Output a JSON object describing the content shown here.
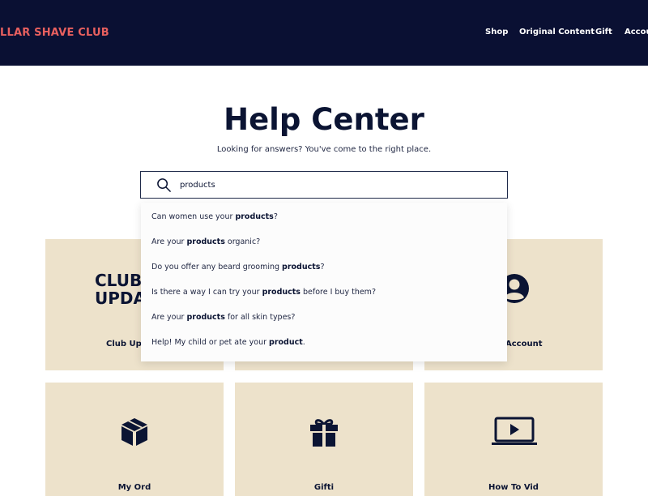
{
  "header": {
    "logo": "LLAR SHAVE CLUB",
    "nav": [
      "Shop",
      "Original Content",
      "Gift",
      "Accoun"
    ]
  },
  "hero": {
    "title": "Help Center",
    "subtitle": "Looking for answers? You've come to the right place."
  },
  "search": {
    "value": "products",
    "suggestions": [
      {
        "pre": "Can women use your ",
        "hl": "products",
        "post": "?"
      },
      {
        "pre": "Are your ",
        "hl": "products",
        "post": " organic?"
      },
      {
        "pre": "Do you offer any beard grooming ",
        "hl": "products",
        "post": "?"
      },
      {
        "pre": "Is there a way I can try your ",
        "hl": "products",
        "post": " before I buy them?"
      },
      {
        "pre": "Are your ",
        "hl": "products",
        "post": " for all skin types?"
      },
      {
        "pre": "Help! My child or pet ate your ",
        "hl": "product",
        "post": "."
      }
    ]
  },
  "cards": {
    "club_icon_text_1": "CLUB",
    "club_icon_text_2": "UPDA",
    "club_label": "Club Up",
    "account_label": "Account",
    "orders_label": "My Ord",
    "gifting_label": "Gifti",
    "video_label": "How To Vid"
  },
  "colors": {
    "header_bg": "#0a1033",
    "logo": "#e8605f",
    "card_bg": "#ede2cb",
    "navy": "#0b1433"
  }
}
